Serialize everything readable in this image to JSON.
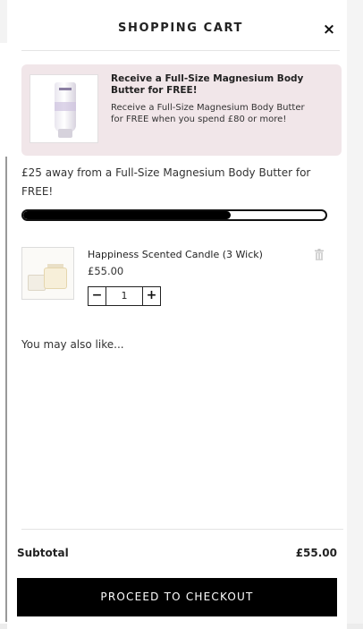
{
  "header": {
    "title": "SHOPPING CART",
    "close_symbol": "×"
  },
  "promo": {
    "heading": "Receive a Full-Size Magnesium Body Butter for FREE!",
    "body": "Receive a Full-Size Magnesium Body Butter for FREE when you spend £80 or more!",
    "image_icon": "body-butter-tube"
  },
  "threshold": {
    "message": "£25 away from a Full-Size Magnesium Body Butter for FREE!",
    "progress_fraction": 0.6875
  },
  "cart": {
    "items": [
      {
        "name": "Happiness Scented Candle (3 Wick)",
        "price": "£55.00",
        "quantity": "1",
        "minus_label": "−",
        "plus_label": "+",
        "remove_icon": "trash-icon"
      }
    ]
  },
  "recommendations": {
    "heading": "You may also like..."
  },
  "footer": {
    "subtotal_label": "Subtotal",
    "subtotal_value": "£55.00",
    "checkout_label": "PROCEED TO CHECKOUT"
  },
  "colors": {
    "promo_bg": "#f1e6e9",
    "button_bg": "#000000",
    "progress_fill": "#000000"
  }
}
